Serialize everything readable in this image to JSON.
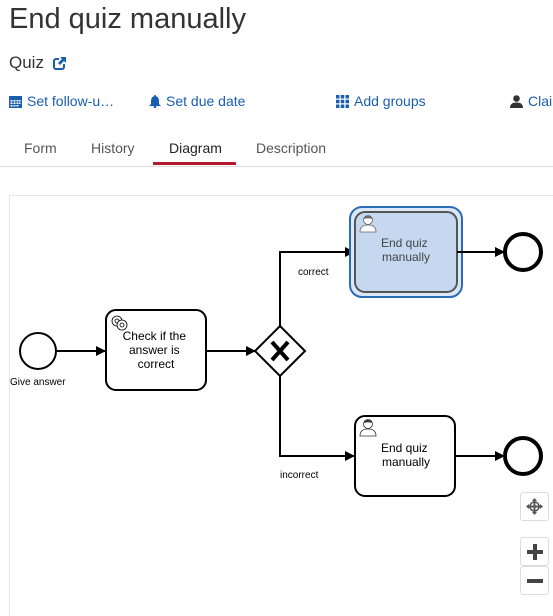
{
  "header": {
    "title": "End quiz manually",
    "process_name": "Quiz",
    "process_link_icon": "external-link-icon"
  },
  "actions": [
    {
      "label": "Set follow-u…",
      "icon": "calendar-icon"
    },
    {
      "label": "Set due date",
      "icon": "bell-icon"
    },
    {
      "label": "Add groups",
      "icon": "grid-icon"
    },
    {
      "label": "Clai",
      "icon": "user-icon"
    }
  ],
  "tabs": [
    {
      "label": "Form",
      "active": false
    },
    {
      "label": "History",
      "active": false
    },
    {
      "label": "Diagram",
      "active": true
    },
    {
      "label": "Description",
      "active": false
    }
  ],
  "colors": {
    "accent": "#b5172d",
    "link": "#1a5eb0",
    "highlight_fill": "#c5d8f0",
    "highlight_border": "#2b6cb8"
  },
  "diagram": {
    "start_event": {
      "label": "Give answer"
    },
    "service_task": {
      "label_lines": [
        "Check if the",
        "answer is",
        "correct"
      ],
      "icon": "gear-icon"
    },
    "gateway": {
      "type": "exclusive",
      "icon": "x-icon"
    },
    "flows": {
      "correct": "correct",
      "incorrect": "incorrect"
    },
    "user_task_top": {
      "label_lines": [
        "End quiz",
        "manually"
      ],
      "icon": "user-icon",
      "highlighted": true
    },
    "user_task_bottom": {
      "label_lines": [
        "End quiz",
        "manually"
      ],
      "icon": "user-icon",
      "highlighted": false
    }
  },
  "zoom_controls": {
    "reset": "crosshair-icon",
    "zoom_in": "plus-icon",
    "zoom_out": "minus-icon"
  }
}
